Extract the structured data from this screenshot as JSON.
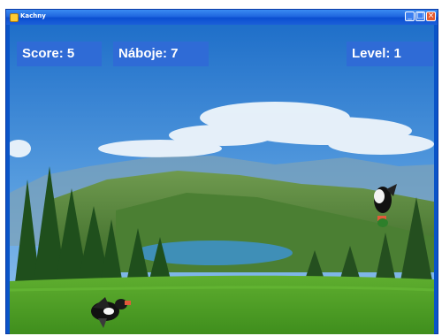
{
  "window": {
    "title": "Kachny"
  },
  "hud": {
    "score_label": "Score: 5",
    "ammo_label": "Náboje: 7",
    "level_label": "Level: 1"
  },
  "colors": {
    "hud_panel": "#2f6bd6",
    "titlebar": "#1f66df"
  },
  "ducks": [
    {
      "name": "duck-left",
      "icon": "duck-icon"
    },
    {
      "name": "duck-right",
      "icon": "duck-icon"
    }
  ]
}
